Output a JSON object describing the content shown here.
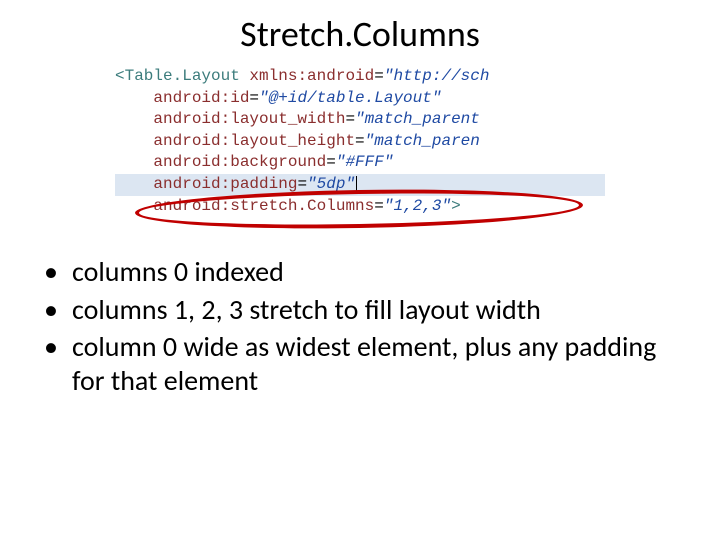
{
  "title": "Stretch.Columns",
  "code": {
    "line1_tag_open": "<Table.Layout",
    "line1_attr": " xmlns:android",
    "line1_eq": "=",
    "line1_val": "\"http://sch",
    "line2_attr": "android:id",
    "line2_val": "\"@+id/table.Layout\"",
    "line3_attr": "android:layout_width",
    "line3_val": "\"match_parent",
    "line4_attr": "android:layout_height",
    "line4_val": "\"match_paren",
    "line5_attr": "android:background",
    "line5_val": "\"#FFF\"",
    "line6_attr": "android:padding",
    "line6_val": "\"5dp\"",
    "line7_attr": "android:stretch.Columns",
    "line7_val": "\"1,2,3\"",
    "line7_close": ">"
  },
  "bullets": [
    "columns 0 indexed",
    "columns 1, 2, 3 stretch to fill layout width",
    "column 0 wide as widest element, plus any padding for that element"
  ],
  "colors": {
    "ellipse": "#c00000",
    "highlight": "#dce6f2"
  }
}
